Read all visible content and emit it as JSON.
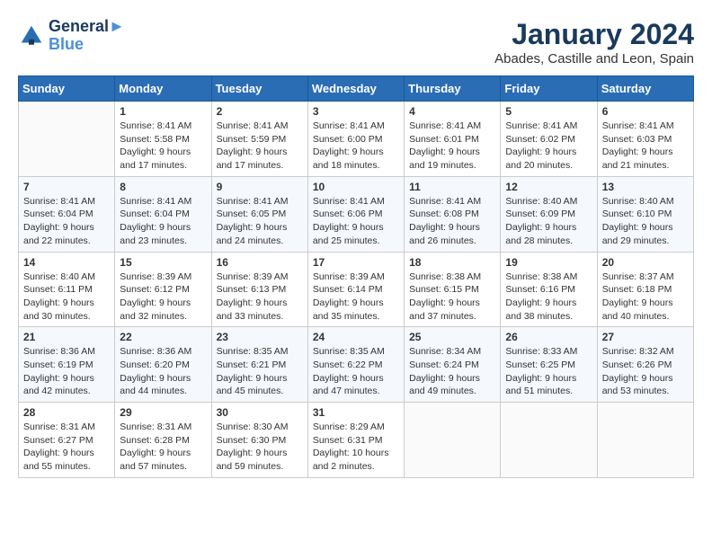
{
  "header": {
    "logo_line1": "General",
    "logo_line2": "Blue",
    "month_title": "January 2024",
    "subtitle": "Abades, Castille and Leon, Spain"
  },
  "days_of_week": [
    "Sunday",
    "Monday",
    "Tuesday",
    "Wednesday",
    "Thursday",
    "Friday",
    "Saturday"
  ],
  "weeks": [
    [
      {
        "day": "",
        "text": ""
      },
      {
        "day": "1",
        "text": "Sunrise: 8:41 AM\nSunset: 5:58 PM\nDaylight: 9 hours\nand 17 minutes."
      },
      {
        "day": "2",
        "text": "Sunrise: 8:41 AM\nSunset: 5:59 PM\nDaylight: 9 hours\nand 17 minutes."
      },
      {
        "day": "3",
        "text": "Sunrise: 8:41 AM\nSunset: 6:00 PM\nDaylight: 9 hours\nand 18 minutes."
      },
      {
        "day": "4",
        "text": "Sunrise: 8:41 AM\nSunset: 6:01 PM\nDaylight: 9 hours\nand 19 minutes."
      },
      {
        "day": "5",
        "text": "Sunrise: 8:41 AM\nSunset: 6:02 PM\nDaylight: 9 hours\nand 20 minutes."
      },
      {
        "day": "6",
        "text": "Sunrise: 8:41 AM\nSunset: 6:03 PM\nDaylight: 9 hours\nand 21 minutes."
      }
    ],
    [
      {
        "day": "7",
        "text": "Sunrise: 8:41 AM\nSunset: 6:04 PM\nDaylight: 9 hours\nand 22 minutes."
      },
      {
        "day": "8",
        "text": "Sunrise: 8:41 AM\nSunset: 6:04 PM\nDaylight: 9 hours\nand 23 minutes."
      },
      {
        "day": "9",
        "text": "Sunrise: 8:41 AM\nSunset: 6:05 PM\nDaylight: 9 hours\nand 24 minutes."
      },
      {
        "day": "10",
        "text": "Sunrise: 8:41 AM\nSunset: 6:06 PM\nDaylight: 9 hours\nand 25 minutes."
      },
      {
        "day": "11",
        "text": "Sunrise: 8:41 AM\nSunset: 6:08 PM\nDaylight: 9 hours\nand 26 minutes."
      },
      {
        "day": "12",
        "text": "Sunrise: 8:40 AM\nSunset: 6:09 PM\nDaylight: 9 hours\nand 28 minutes."
      },
      {
        "day": "13",
        "text": "Sunrise: 8:40 AM\nSunset: 6:10 PM\nDaylight: 9 hours\nand 29 minutes."
      }
    ],
    [
      {
        "day": "14",
        "text": "Sunrise: 8:40 AM\nSunset: 6:11 PM\nDaylight: 9 hours\nand 30 minutes."
      },
      {
        "day": "15",
        "text": "Sunrise: 8:39 AM\nSunset: 6:12 PM\nDaylight: 9 hours\nand 32 minutes."
      },
      {
        "day": "16",
        "text": "Sunrise: 8:39 AM\nSunset: 6:13 PM\nDaylight: 9 hours\nand 33 minutes."
      },
      {
        "day": "17",
        "text": "Sunrise: 8:39 AM\nSunset: 6:14 PM\nDaylight: 9 hours\nand 35 minutes."
      },
      {
        "day": "18",
        "text": "Sunrise: 8:38 AM\nSunset: 6:15 PM\nDaylight: 9 hours\nand 37 minutes."
      },
      {
        "day": "19",
        "text": "Sunrise: 8:38 AM\nSunset: 6:16 PM\nDaylight: 9 hours\nand 38 minutes."
      },
      {
        "day": "20",
        "text": "Sunrise: 8:37 AM\nSunset: 6:18 PM\nDaylight: 9 hours\nand 40 minutes."
      }
    ],
    [
      {
        "day": "21",
        "text": "Sunrise: 8:36 AM\nSunset: 6:19 PM\nDaylight: 9 hours\nand 42 minutes."
      },
      {
        "day": "22",
        "text": "Sunrise: 8:36 AM\nSunset: 6:20 PM\nDaylight: 9 hours\nand 44 minutes."
      },
      {
        "day": "23",
        "text": "Sunrise: 8:35 AM\nSunset: 6:21 PM\nDaylight: 9 hours\nand 45 minutes."
      },
      {
        "day": "24",
        "text": "Sunrise: 8:35 AM\nSunset: 6:22 PM\nDaylight: 9 hours\nand 47 minutes."
      },
      {
        "day": "25",
        "text": "Sunrise: 8:34 AM\nSunset: 6:24 PM\nDaylight: 9 hours\nand 49 minutes."
      },
      {
        "day": "26",
        "text": "Sunrise: 8:33 AM\nSunset: 6:25 PM\nDaylight: 9 hours\nand 51 minutes."
      },
      {
        "day": "27",
        "text": "Sunrise: 8:32 AM\nSunset: 6:26 PM\nDaylight: 9 hours\nand 53 minutes."
      }
    ],
    [
      {
        "day": "28",
        "text": "Sunrise: 8:31 AM\nSunset: 6:27 PM\nDaylight: 9 hours\nand 55 minutes."
      },
      {
        "day": "29",
        "text": "Sunrise: 8:31 AM\nSunset: 6:28 PM\nDaylight: 9 hours\nand 57 minutes."
      },
      {
        "day": "30",
        "text": "Sunrise: 8:30 AM\nSunset: 6:30 PM\nDaylight: 9 hours\nand 59 minutes."
      },
      {
        "day": "31",
        "text": "Sunrise: 8:29 AM\nSunset: 6:31 PM\nDaylight: 10 hours\nand 2 minutes."
      },
      {
        "day": "",
        "text": ""
      },
      {
        "day": "",
        "text": ""
      },
      {
        "day": "",
        "text": ""
      }
    ]
  ]
}
